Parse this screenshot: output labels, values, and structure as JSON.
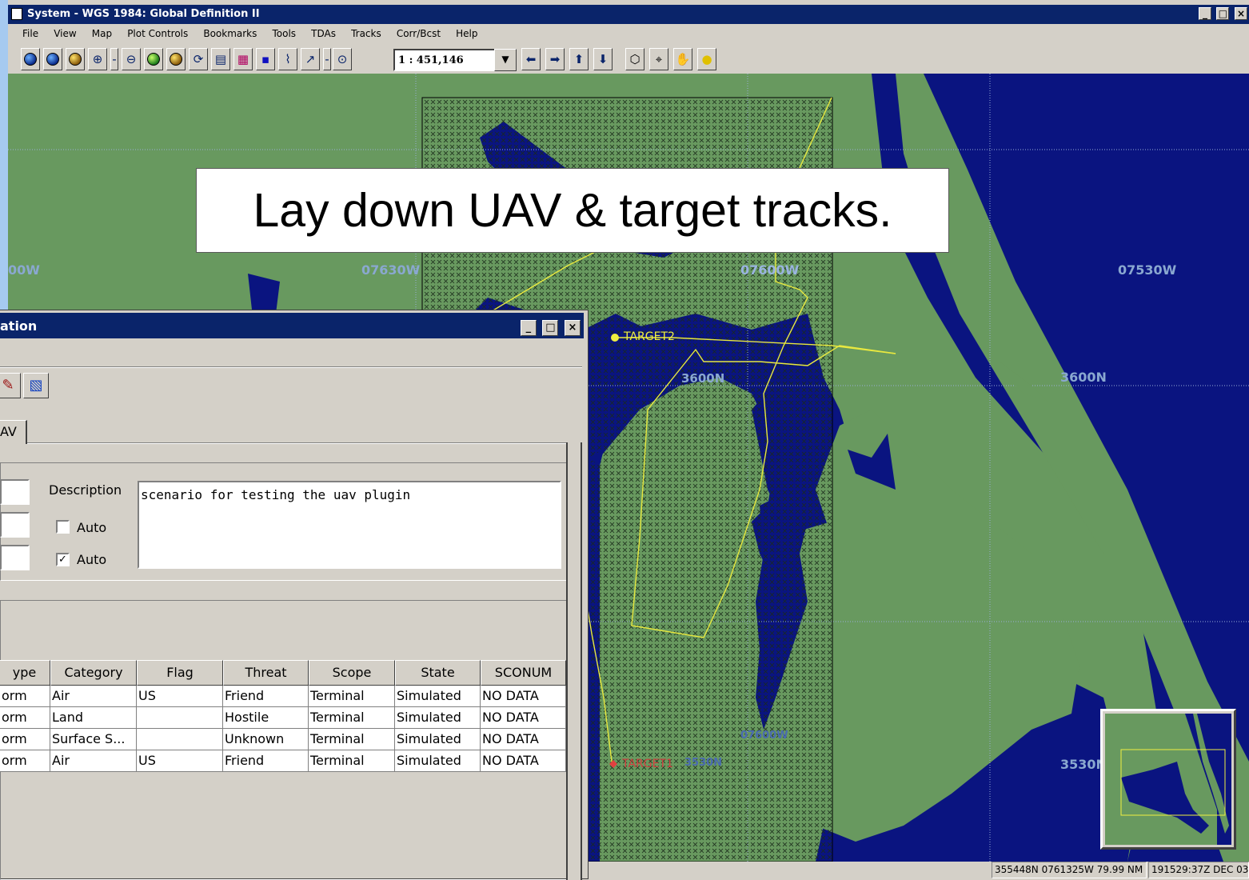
{
  "window": {
    "title": "System - WGS 1984: Global Definition II",
    "controls": [
      "_",
      "□",
      "×"
    ]
  },
  "menu": [
    "File",
    "View",
    "Map",
    "Plot Controls",
    "Bookmarks",
    "Tools",
    "TDAs",
    "Tracks",
    "Corr/Bcst",
    "Help"
  ],
  "toolbar": {
    "scale_value": "1 : 451,146",
    "icons": [
      "globe-icon",
      "globe-icon",
      "globe-icon",
      "zoom-in-icon",
      "zoom-out-icon",
      "globe-icon",
      "globe-icon",
      "refresh-icon",
      "print-icon",
      "grid-icon",
      "flag-icon",
      "bearing-icon",
      "line-icon",
      "circle-icon",
      "pan-left-icon",
      "pan-right-icon",
      "pan-up-icon",
      "pan-down-icon",
      "select-icon",
      "center-icon",
      "hand-icon",
      "sun-icon"
    ]
  },
  "map": {
    "grid_labels": {
      "lon_left": "00W",
      "lon_1": "07630W",
      "lon_2": "07600W",
      "lon_3": "07530W",
      "lat_1": "3600N",
      "lat_2": "3600N",
      "lat_3": "3530N",
      "lat_4": "3530N",
      "lon_faint": "07600W"
    },
    "tracks": {
      "target2": "TARGET2",
      "target1": "TARGET1"
    },
    "colors": {
      "land": "#68995f",
      "water": "#0a1480",
      "track": "#e8e840",
      "target1": "#d04040",
      "grid_label": "#8aa8d0"
    }
  },
  "caption": "Lay down UAV & target tracks.",
  "status": {
    "position": "355448N 0761325W  79.99 NM",
    "time": "191529:37Z DEC 03"
  },
  "dialog": {
    "title": "ation",
    "tab_label": "AV",
    "description_label": "Description",
    "description_value": "scenario for testing the uav plugin",
    "auto1_label": "Auto",
    "auto1_checked": false,
    "auto2_label": "Auto",
    "auto2_checked": true,
    "columns": [
      "ype",
      "Category",
      "Flag",
      "Threat",
      "Scope",
      "State",
      "SCONUM"
    ],
    "rows": [
      [
        "orm",
        "Air",
        "US",
        "Friend",
        "Terminal",
        "Simulated",
        "NO DATA"
      ],
      [
        "orm",
        "Land",
        "",
        "Hostile",
        "Terminal",
        "Simulated",
        "NO DATA"
      ],
      [
        "orm",
        "Surface S...",
        "",
        "Unknown",
        "Terminal",
        "Simulated",
        "NO DATA"
      ],
      [
        "orm",
        "Air",
        "US",
        "Friend",
        "Terminal",
        "Simulated",
        "NO DATA"
      ]
    ]
  }
}
